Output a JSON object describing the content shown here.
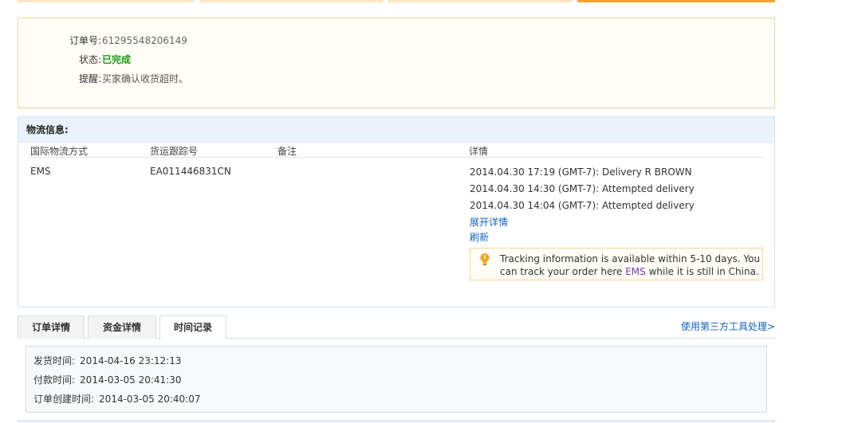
{
  "order": {
    "number_label": "订单号:",
    "number_value": "61295548206149",
    "status_label": "状态:",
    "status_value": "已完成",
    "status_color": "#1a9b14",
    "reminder_label": "提醒:",
    "reminder_value": "买家确认收货超时。"
  },
  "logistics": {
    "title": "物流信息:",
    "columns": [
      "国际物流方式",
      "货运跟踪号",
      "备注",
      "详情"
    ],
    "method": "EMS",
    "tracking_number": "EA011446831CN",
    "remark": "",
    "events": [
      "2014.04.30 17:19 (GMT-7): Delivery R BROWN",
      "2014.04.30 14:30 (GMT-7): Attempted delivery",
      "2014.04.30 14:04 (GMT-7): Attempted delivery"
    ],
    "expand_link": "展开详情",
    "refresh_link": "刷新",
    "notice_prefix": "Tracking information is available within 5-10 days. You can track your order here ",
    "notice_link": "EMS",
    "notice_suffix": " while it is still in China.",
    "notice_icon": "lightbulb-icon"
  },
  "tabs": {
    "items": [
      "订单详情",
      "资金详情",
      "时间记录"
    ],
    "active": "时间记录",
    "third_party_link": "使用第三方工具处理>"
  },
  "time_record": {
    "ship_label": "发货时间:",
    "ship_value": "2014-04-16 23:12:13",
    "pay_label": "付款时间:",
    "pay_value": "2014-03-05 20:41:30",
    "created_label": "订单创建时间:",
    "created_value": "2014-03-05 20:40:07"
  },
  "colors": {
    "accent_orange": "#f7a42b",
    "link_blue": "#1061c2",
    "header_blue": "#eaf2fb"
  }
}
